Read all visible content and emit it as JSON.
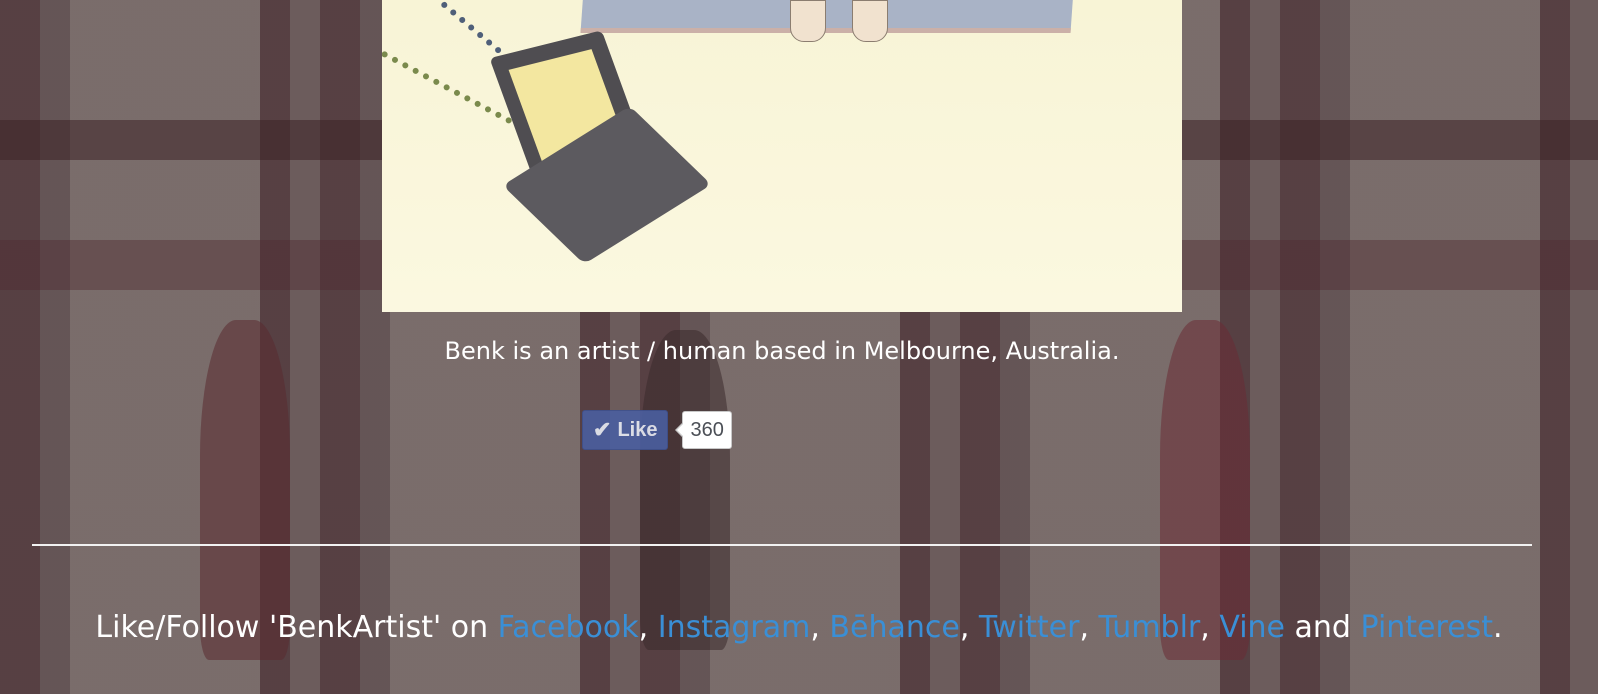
{
  "caption": "Benk is an artist / human based in Melbourne, Australia.",
  "like_widget": {
    "button_label": "Like",
    "count": "360",
    "button_color": "#4a5fa0"
  },
  "follow": {
    "prefix": "Like/Follow 'BenkArtist' on ",
    "links": [
      {
        "label": "Facebook"
      },
      {
        "label": "Instagram"
      },
      {
        "label": "Bēhance"
      },
      {
        "label": "Twitter"
      },
      {
        "label": "Tumblr"
      },
      {
        "label": "Vine"
      },
      {
        "label": "Pinterest"
      }
    ],
    "separator": ", ",
    "conjunction": " and ",
    "suffix": ".",
    "link_color": "#3a8fd6"
  },
  "icons": {
    "like_check": "check-icon"
  }
}
